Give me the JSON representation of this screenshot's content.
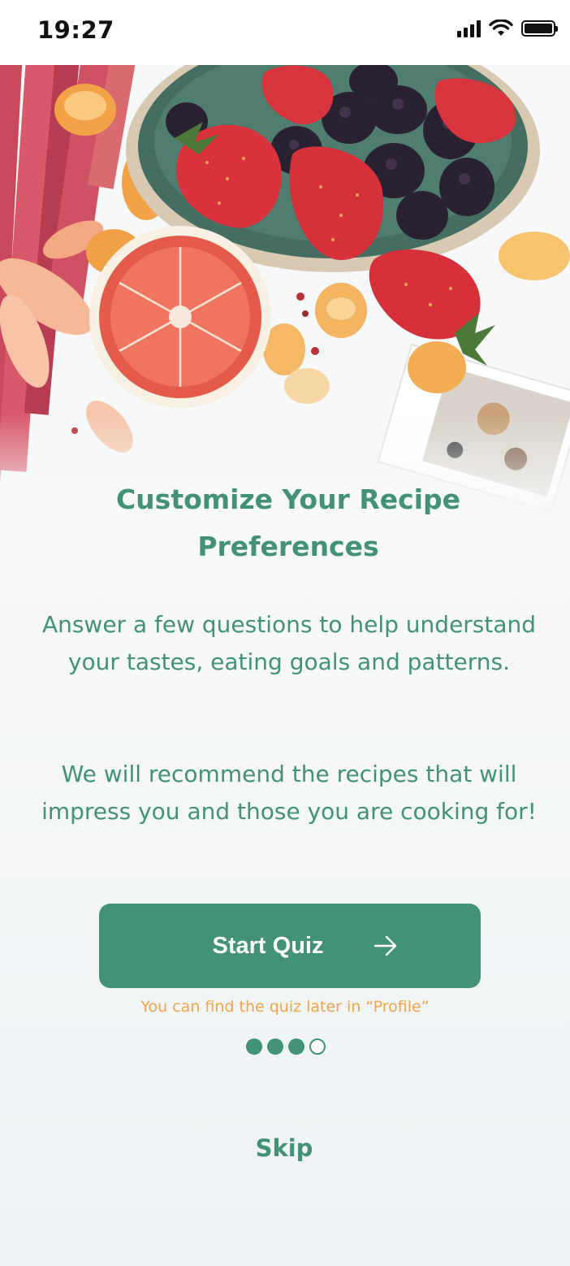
{
  "status_bar": {
    "time": "19:27"
  },
  "onboarding": {
    "title": "Customize Your Recipe Preferences",
    "paragraph_1": "Answer a few questions to help understand your tastes, eating goals and patterns.",
    "paragraph_2": "We will recommend the recipes that will impress you and those you are cooking for!",
    "start_button_label": "Start Quiz",
    "hint": "You can find the quiz later in “Profile”",
    "skip_label": "Skip",
    "pagination": {
      "current": 3,
      "total": 4
    }
  },
  "colors": {
    "brand_green": "#439177",
    "hint_orange": "#f0a34c"
  }
}
